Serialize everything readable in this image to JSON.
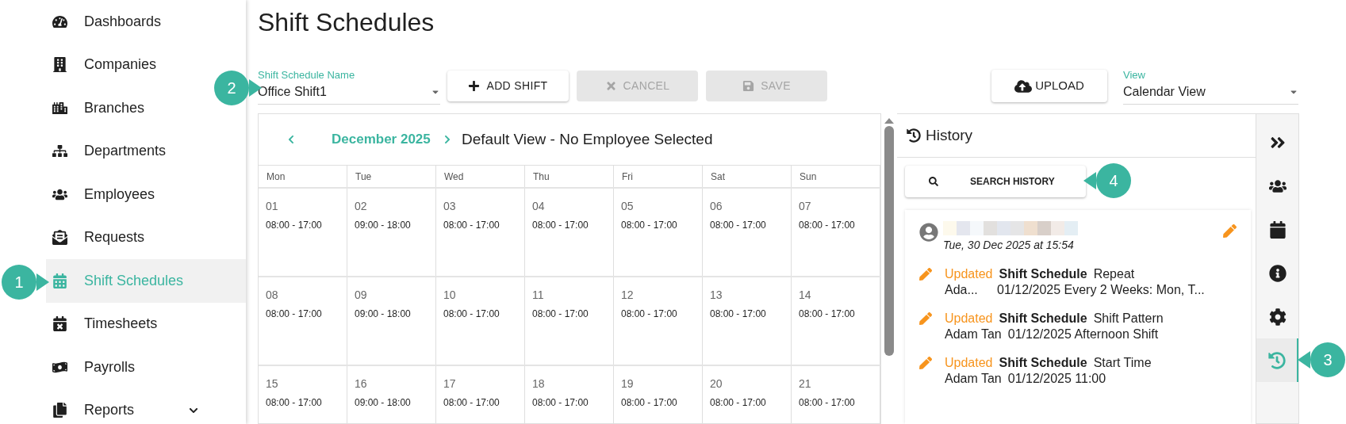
{
  "sidebar": {
    "items": [
      {
        "label": "Dashboards",
        "kind": "link",
        "selected": false
      },
      {
        "label": "Companies",
        "kind": "link",
        "selected": false
      },
      {
        "label": "Branches",
        "kind": "link",
        "selected": false
      },
      {
        "label": "Departments",
        "kind": "link",
        "selected": false
      },
      {
        "label": "Employees",
        "kind": "link",
        "selected": false
      },
      {
        "label": "Requests",
        "kind": "link",
        "selected": false
      },
      {
        "label": "Shift Schedules",
        "kind": "link",
        "selected": true
      },
      {
        "label": "Timesheets",
        "kind": "link",
        "selected": false
      },
      {
        "label": "Payrolls",
        "kind": "link",
        "selected": false
      },
      {
        "label": "Reports",
        "kind": "group",
        "selected": false
      }
    ]
  },
  "page_title": "Shift Schedules",
  "schedule_select": {
    "label": "Shift Schedule Name",
    "value": "Office Shift1"
  },
  "buttons": [
    {
      "label": "ADD SHIFT",
      "disabled": false
    },
    {
      "label": "CANCEL",
      "disabled": true
    },
    {
      "label": "SAVE",
      "disabled": true
    }
  ],
  "upload_button": {
    "label": "UPLOAD"
  },
  "view_select": {
    "label": "View",
    "value": "Calendar View"
  },
  "calendar": {
    "month": "December 2025",
    "view_title": "Default View - No Employee Selected",
    "weekdays": [
      "Mon",
      "Tue",
      "Wed",
      "Thu",
      "Fri",
      "Sat",
      "Sun"
    ],
    "weeks": [
      [
        {
          "day": "01",
          "shift": "08:00 - 17:00"
        },
        {
          "day": "02",
          "shift": "09:00 - 18:00"
        },
        {
          "day": "03",
          "shift": "08:00 - 17:00"
        },
        {
          "day": "04",
          "shift": "08:00 - 17:00"
        },
        {
          "day": "05",
          "shift": "08:00 - 17:00"
        },
        {
          "day": "06",
          "shift": "08:00 - 17:00"
        },
        {
          "day": "07",
          "shift": "08:00 - 17:00"
        }
      ],
      [
        {
          "day": "08",
          "shift": "08:00 - 17:00"
        },
        {
          "day": "09",
          "shift": "09:00 - 18:00"
        },
        {
          "day": "10",
          "shift": "08:00 - 17:00"
        },
        {
          "day": "11",
          "shift": "08:00 - 17:00"
        },
        {
          "day": "12",
          "shift": "08:00 - 17:00"
        },
        {
          "day": "13",
          "shift": "08:00 - 17:00"
        },
        {
          "day": "14",
          "shift": "08:00 - 17:00"
        }
      ],
      [
        {
          "day": "15",
          "shift": "08:00 - 17:00"
        },
        {
          "day": "16",
          "shift": "09:00 - 18:00"
        },
        {
          "day": "17",
          "shift": "08:00 - 17:00"
        },
        {
          "day": "18",
          "shift": "08:00 - 17:00"
        },
        {
          "day": "19",
          "shift": "08:00 - 17:00"
        },
        {
          "day": "20",
          "shift": "08:00 - 17:00"
        },
        {
          "day": "21",
          "shift": "08:00 - 17:00"
        }
      ]
    ]
  },
  "history": {
    "title": "History",
    "search_button": "SEARCH HISTORY",
    "card": {
      "date": "Tue, 30 Dec 2025 at 15:54",
      "entries": [
        {
          "action": "Updated",
          "entity": "Shift Schedule",
          "field": "Repeat",
          "user": "Ada...",
          "detail": "01/12/2025 Every 2 Weeks: Mon, T..."
        },
        {
          "action": "Updated",
          "entity": "Shift Schedule",
          "field": "Shift Pattern",
          "user": "Adam Tan",
          "detail": "01/12/2025 Afternoon Shift"
        },
        {
          "action": "Updated",
          "entity": "Shift Schedule",
          "field": "Start Time",
          "user": "Adam Tan",
          "detail": "01/12/2025 11:00"
        }
      ]
    }
  },
  "rail": {
    "items": [
      {
        "selected": false
      },
      {
        "selected": false
      },
      {
        "selected": false
      },
      {
        "selected": false
      },
      {
        "selected": false
      },
      {
        "selected": true
      }
    ]
  },
  "callouts": [
    {
      "number": "1",
      "kind": "right"
    },
    {
      "number": "2",
      "kind": "right"
    },
    {
      "number": "3",
      "kind": "left"
    },
    {
      "number": "4",
      "kind": "left"
    }
  ]
}
